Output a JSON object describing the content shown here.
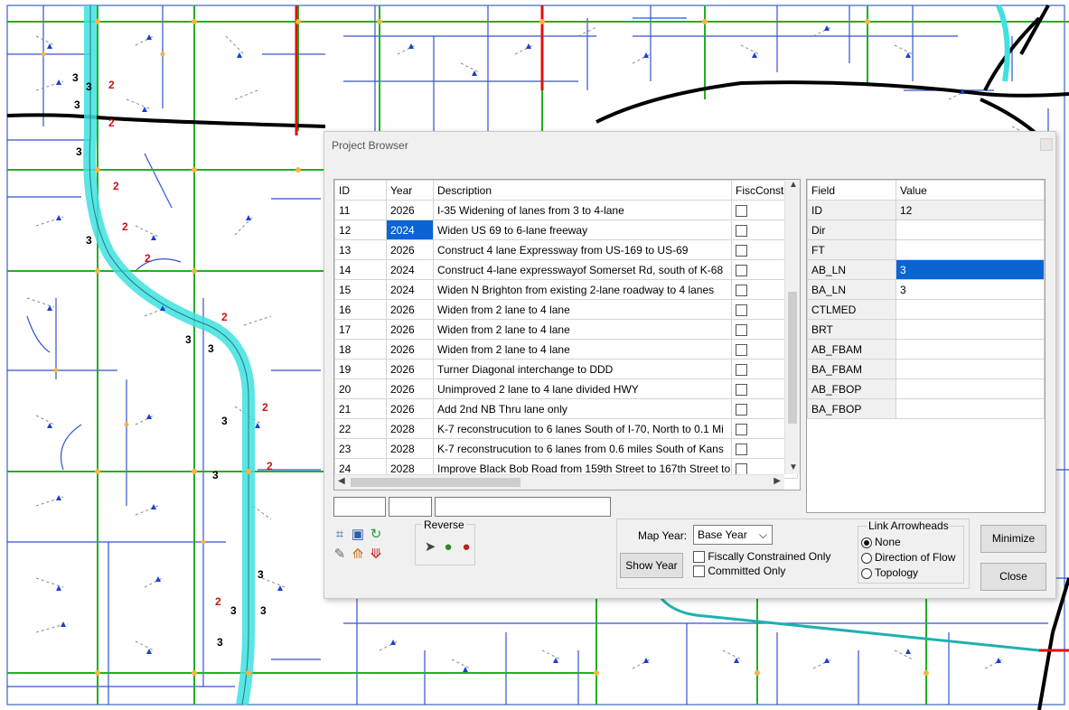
{
  "dialog": {
    "title": "Project Browser",
    "project_table": {
      "headers": [
        "ID",
        "Year",
        "Description",
        "FiscConst"
      ],
      "rows": [
        {
          "id": "11",
          "year": "2026",
          "desc": "I-35 Widening of lanes from 3 to 4-lane"
        },
        {
          "id": "12",
          "year": "2024",
          "desc": "Widen US 69 to 6-lane freeway"
        },
        {
          "id": "13",
          "year": "2026",
          "desc": "Construct 4 lane Expressway from US-169 to US-69"
        },
        {
          "id": "14",
          "year": "2024",
          "desc": "Construct 4-lane expresswayof Somerset Rd, south of K-68"
        },
        {
          "id": "15",
          "year": "2024",
          "desc": "Widen N Brighton from existing 2-lane roadway to 4 lanes"
        },
        {
          "id": "16",
          "year": "2026",
          "desc": "Widen from 2 lane to 4 lane"
        },
        {
          "id": "17",
          "year": "2026",
          "desc": "Widen from 2 lane to 4 lane"
        },
        {
          "id": "18",
          "year": "2026",
          "desc": "Widen from 2 lane to 4 lane"
        },
        {
          "id": "19",
          "year": "2026",
          "desc": "Turner Diagonal interchange to DDD"
        },
        {
          "id": "20",
          "year": "2026",
          "desc": "Unimproved 2 lane to 4 lane divided HWY"
        },
        {
          "id": "21",
          "year": "2026",
          "desc": "Add 2nd NB Thru lane only"
        },
        {
          "id": "22",
          "year": "2028",
          "desc": "K-7 reconstrucution to 6 lanes South of I-70, North to 0.1 Mi"
        },
        {
          "id": "23",
          "year": "2028",
          "desc": "K-7 reconstrucution to 6 lanes  from 0.6 miles South of Kans"
        },
        {
          "id": "24",
          "year": "2028",
          "desc": "Improve Black Bob Road from 159th Street to 167th Street to"
        }
      ]
    },
    "field_table": {
      "headers": [
        "Field",
        "Value"
      ],
      "rows": [
        {
          "field": "ID",
          "value": "12"
        },
        {
          "field": "Dir",
          "value": ""
        },
        {
          "field": "FT",
          "value": ""
        },
        {
          "field": "AB_LN",
          "value": "3"
        },
        {
          "field": "BA_LN",
          "value": "3"
        },
        {
          "field": "CTLMED",
          "value": ""
        },
        {
          "field": "BRT",
          "value": ""
        },
        {
          "field": "AB_FBAM",
          "value": ""
        },
        {
          "field": "BA_FBAM",
          "value": ""
        },
        {
          "field": "AB_FBOP",
          "value": ""
        },
        {
          "field": "BA_FBOP",
          "value": ""
        }
      ]
    },
    "reverse_label": "Reverse",
    "map_year_label": "Map Year:",
    "map_year_value": "Base Year",
    "show_year_label": "Show Year",
    "fiscally_constrained_label": "Fiscally Constrained Only",
    "committed_label": "Committed Only",
    "link_arrowheads": {
      "title": "Link Arrowheads",
      "options": [
        "None",
        "Direction of Flow",
        "Topology"
      ],
      "selected": "None"
    },
    "minimize_label": "Minimize",
    "close_label": "Close"
  },
  "colors": {
    "selection": "#0a64d2",
    "highlight_route": "#40e0e0",
    "freeway": "#000000",
    "arterial": "#22b022",
    "collector": "#3355cc",
    "project_link": "#e01010"
  },
  "map_lane_labels": [
    "3",
    "2"
  ]
}
